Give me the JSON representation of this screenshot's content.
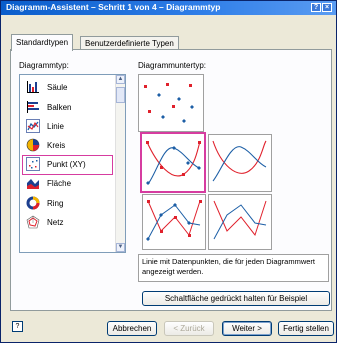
{
  "window": {
    "title": "Diagramm-Assistent – Schritt 1 von 4 – Diagrammtyp",
    "help_glyph": "?",
    "close_glyph": "×"
  },
  "tabs": [
    {
      "label": "Standardtypen",
      "active": true
    },
    {
      "label": "Benutzerdefinierte Typen",
      "active": false
    }
  ],
  "left": {
    "label": "Diagrammtyp:",
    "items": [
      {
        "label": "Säule",
        "icon": "column-chart-icon"
      },
      {
        "label": "Balken",
        "icon": "bar-chart-icon"
      },
      {
        "label": "Linie",
        "icon": "line-chart-icon"
      },
      {
        "label": "Kreis",
        "icon": "pie-chart-icon"
      },
      {
        "label": "Punkt (XY)",
        "icon": "scatter-chart-icon",
        "selected": true
      },
      {
        "label": "Fläche",
        "icon": "area-chart-icon"
      },
      {
        "label": "Ring",
        "icon": "doughnut-chart-icon"
      },
      {
        "label": "Netz",
        "icon": "radar-chart-icon"
      }
    ],
    "scroll_up": "▲",
    "scroll_down": "▼"
  },
  "right": {
    "label": "Diagrammuntertyp:",
    "selected_subtype_index": 1,
    "description": "Linie mit Datenpunkten, die für jeden Diagrammwert angezeigt werden.",
    "preview_button": "Schaltfläche gedrückt halten für Beispiel"
  },
  "footer": {
    "help_icon": "help-icon",
    "cancel": "Abbrechen",
    "back": "< Zurück",
    "next": "Weiter >",
    "finish": "Fertig stellen"
  },
  "colors": {
    "accent": "#d63ca0",
    "series1": "#e0212c",
    "series2": "#1d5fa6",
    "title_bar": "#0a5dcb"
  }
}
